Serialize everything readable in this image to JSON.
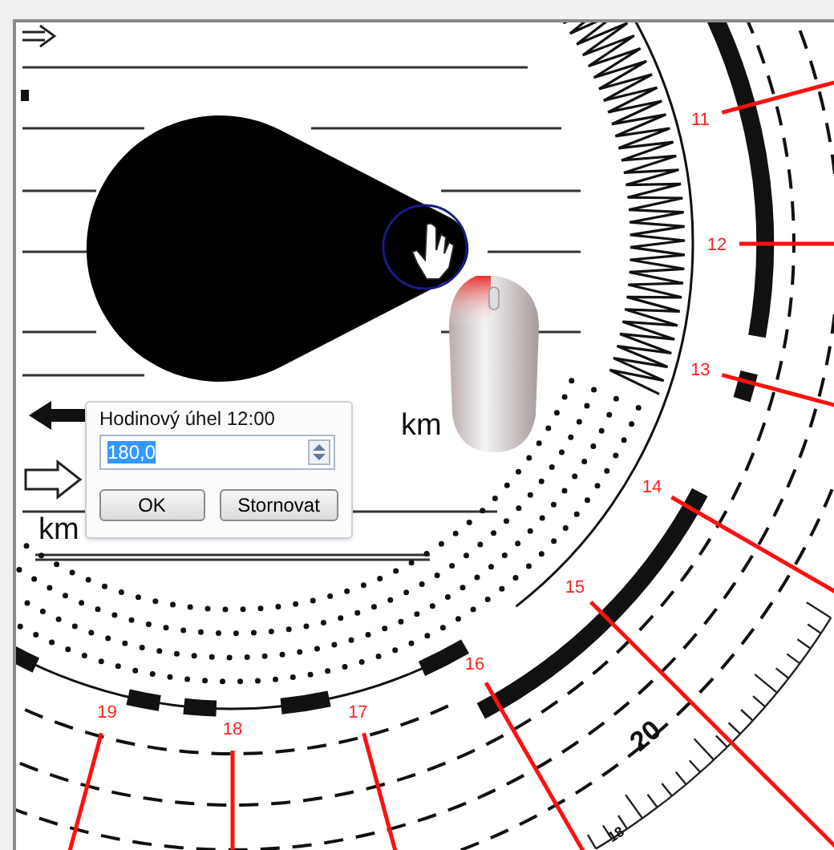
{
  "canvas": {
    "hour_labels": [
      "11",
      "12",
      "13",
      "14",
      "15",
      "16",
      "17",
      "18",
      "19"
    ],
    "scale_labels": [
      "20",
      "18"
    ],
    "km_labels": [
      "km",
      "km"
    ]
  },
  "dialog": {
    "title": "Hodinový úhel 12:00",
    "value": "180,0",
    "text_selected": true,
    "buttons": [
      "OK",
      "Stornovat"
    ]
  }
}
